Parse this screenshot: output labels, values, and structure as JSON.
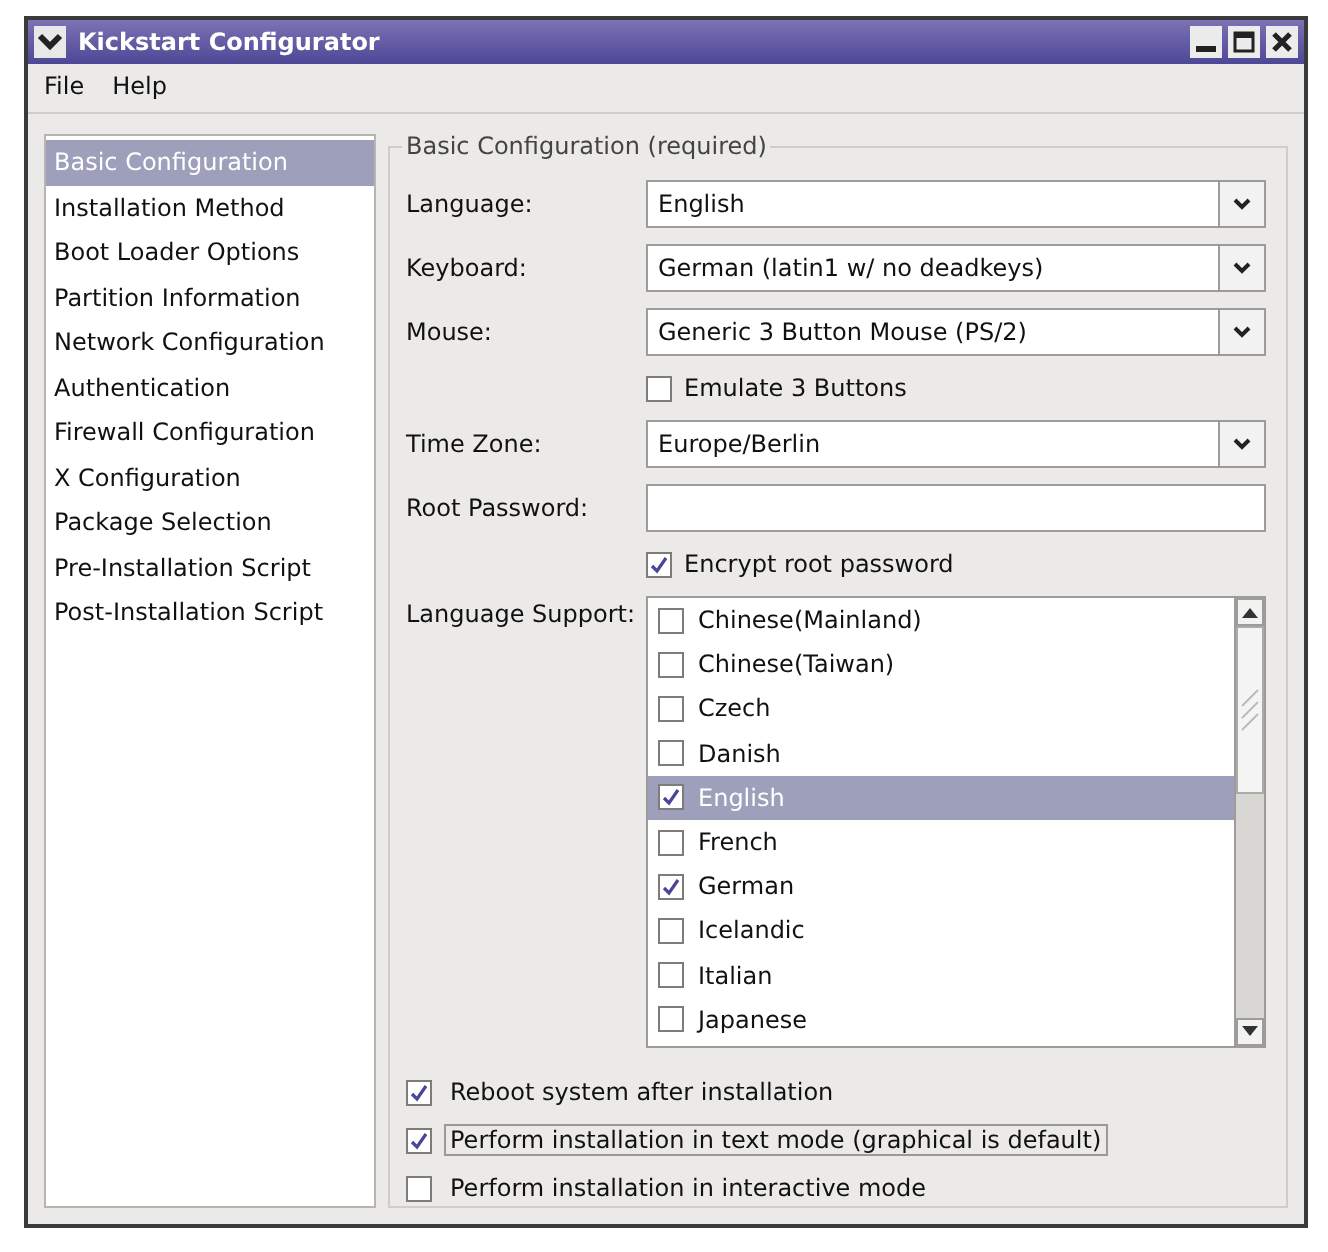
{
  "window": {
    "title": "Kickstart Configurator"
  },
  "menu": [
    {
      "label": "File"
    },
    {
      "label": "Help"
    }
  ],
  "sidebar": {
    "items": [
      {
        "label": "Basic Configuration",
        "selected": true
      },
      {
        "label": "Installation Method",
        "selected": false
      },
      {
        "label": "Boot Loader Options",
        "selected": false
      },
      {
        "label": "Partition Information",
        "selected": false
      },
      {
        "label": "Network Configuration",
        "selected": false
      },
      {
        "label": "Authentication",
        "selected": false
      },
      {
        "label": "Firewall Configuration",
        "selected": false
      },
      {
        "label": "X Configuration",
        "selected": false
      },
      {
        "label": "Package Selection",
        "selected": false
      },
      {
        "label": "Pre-Installation Script",
        "selected": false
      },
      {
        "label": "Post-Installation Script",
        "selected": false
      }
    ]
  },
  "group": {
    "title": "Basic Configuration (required)",
    "fields": [
      {
        "kind": "combo",
        "label": "Language:",
        "value": "English"
      },
      {
        "kind": "combo",
        "label": "Keyboard:",
        "value": "German (latin1 w/ no deadkeys)"
      },
      {
        "kind": "combo",
        "label": "Mouse:",
        "value": "Generic 3 Button Mouse (PS/2)"
      },
      {
        "kind": "checkbox",
        "label": "Emulate 3 Buttons",
        "checked": false
      },
      {
        "kind": "combo",
        "label": "Time Zone:",
        "value": "Europe/Berlin"
      },
      {
        "kind": "password",
        "label": "Root Password:"
      },
      {
        "kind": "checkbox",
        "label": "Encrypt root password",
        "checked": true
      }
    ],
    "language_support": {
      "label": "Language Support:",
      "items": [
        {
          "label": "Chinese(Mainland)",
          "checked": false,
          "selected": false
        },
        {
          "label": "Chinese(Taiwan)",
          "checked": false,
          "selected": false
        },
        {
          "label": "Czech",
          "checked": false,
          "selected": false
        },
        {
          "label": "Danish",
          "checked": false,
          "selected": false
        },
        {
          "label": "English",
          "checked": true,
          "selected": true
        },
        {
          "label": "French",
          "checked": false,
          "selected": false
        },
        {
          "label": "German",
          "checked": true,
          "selected": false
        },
        {
          "label": "Icelandic",
          "checked": false,
          "selected": false
        },
        {
          "label": "Italian",
          "checked": false,
          "selected": false
        },
        {
          "label": "Japanese",
          "checked": false,
          "selected": false
        }
      ]
    },
    "options": [
      {
        "label": "Reboot system after installation",
        "checked": true,
        "focused": false
      },
      {
        "label": "Perform installation in text mode (graphical is default)",
        "checked": true,
        "focused": true
      },
      {
        "label": "Perform installation in interactive mode",
        "checked": false,
        "focused": false
      }
    ]
  }
}
